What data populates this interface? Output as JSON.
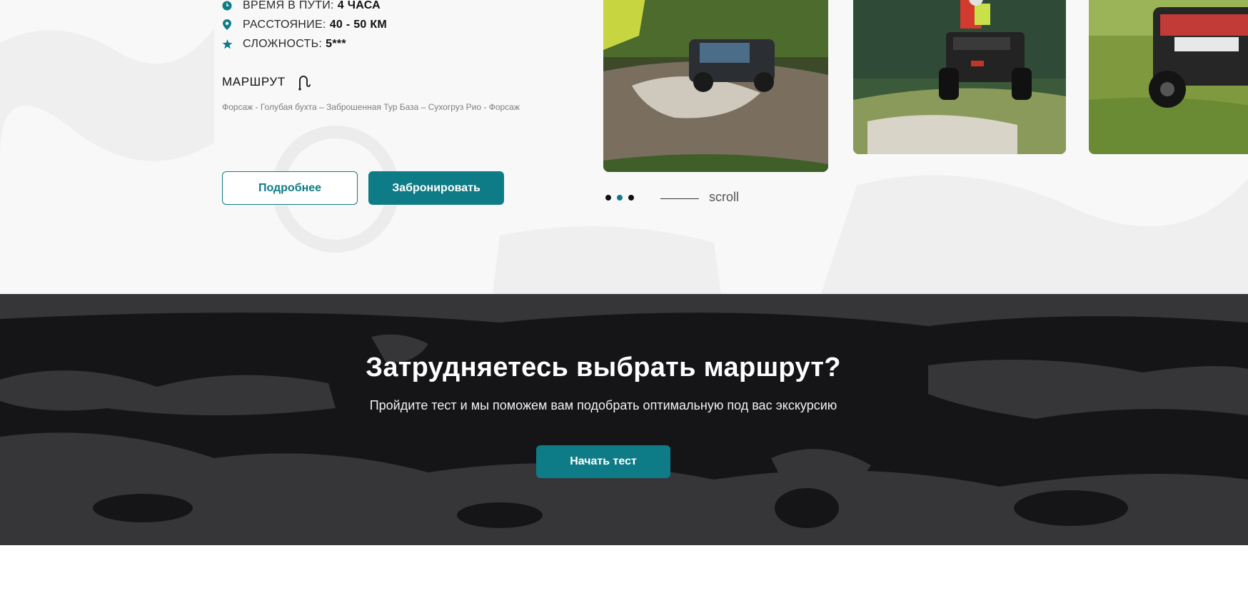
{
  "tour": {
    "info": [
      {
        "label": "ВРЕМЯ В ПУТИ:",
        "value": "4 ЧАСА",
        "icon": "clock-icon"
      },
      {
        "label": "РАССТОЯНИЕ:",
        "value": "40 - 50 КМ",
        "icon": "location-pin-icon"
      },
      {
        "label": "СЛОЖНОСТЬ:",
        "value": "5***",
        "icon": "star-icon"
      }
    ],
    "route_title": "МАРШРУТ",
    "route_icon": "route-icon",
    "route_text": "Форсаж - Голубая бухта – Заброшенная Тур База – Сухогруз Рио - Форсаж",
    "details_label": "Подробнее",
    "book_label": "Забронировать",
    "carousel": {
      "active_dot": 2,
      "dot_count": 3,
      "scroll_label": "scroll"
    }
  },
  "quiz": {
    "title": "Затрудняетесь выбрать маршрут?",
    "subtitle": "Пройдите тест и мы поможем вам подобрать оптимальную под вас экскурсию",
    "button_label": "Начать тест"
  },
  "colors": {
    "accent": "#0e7c86",
    "dark_bg": "#151517",
    "light_bg": "#f8f8f8"
  }
}
